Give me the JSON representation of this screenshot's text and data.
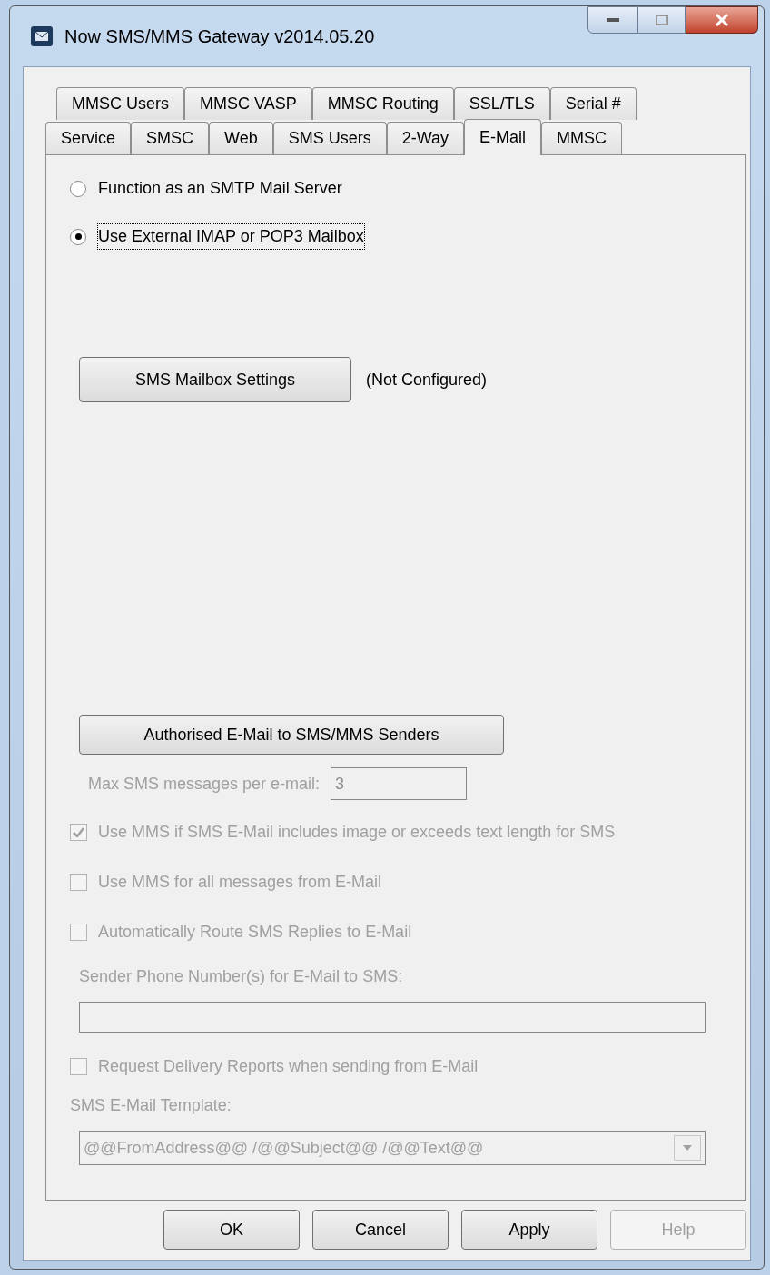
{
  "window": {
    "title": "Now SMS/MMS Gateway v2014.05.20"
  },
  "tab_rows": [
    [
      {
        "label": "MMSC Users",
        "selected": false
      },
      {
        "label": "MMSC VASP",
        "selected": false
      },
      {
        "label": "MMSC Routing",
        "selected": false
      },
      {
        "label": "SSL/TLS",
        "selected": false
      },
      {
        "label": "Serial #",
        "selected": false
      }
    ],
    [
      {
        "label": "Service",
        "selected": false
      },
      {
        "label": "SMSC",
        "selected": false
      },
      {
        "label": "Web",
        "selected": false
      },
      {
        "label": "SMS Users",
        "selected": false
      },
      {
        "label": "2-Way",
        "selected": false
      },
      {
        "label": "E-Mail",
        "selected": true
      },
      {
        "label": "MMSC",
        "selected": false
      }
    ]
  ],
  "mode_options": [
    {
      "label": "Function as an SMTP Mail Server",
      "selected": false
    },
    {
      "label": "Use External IMAP or POP3 Mailbox",
      "selected": true
    }
  ],
  "mailbox_button": {
    "label": "SMS Mailbox Settings",
    "status": "(Not Configured)"
  },
  "senders_button": {
    "label": "Authorised E-Mail to SMS/MMS Senders"
  },
  "max_messages": {
    "label": "Max SMS messages per e-mail:",
    "value": "3",
    "disabled": true
  },
  "options": [
    {
      "label": "Use MMS if SMS E-Mail includes image or exceeds text length for SMS",
      "checked": true,
      "disabled": true
    },
    {
      "label": "Use MMS for all messages from E-Mail",
      "checked": false,
      "disabled": true
    },
    {
      "label": "Automatically Route SMS Replies to E-Mail",
      "checked": false,
      "disabled": true
    }
  ],
  "sender_numbers": {
    "label": "Sender Phone Number(s) for E-Mail to SMS:",
    "disabled": true
  },
  "delivery_reports": {
    "label": "Request Delivery Reports when sending from E-Mail",
    "checked": false,
    "disabled": true
  },
  "template": {
    "label": "SMS E-Mail Template:",
    "value": "@@FromAddress@@ /@@Subject@@ /@@Text@@",
    "disabled": true
  },
  "buttons": [
    {
      "label": "OK",
      "disabled": false
    },
    {
      "label": "Cancel",
      "disabled": false
    },
    {
      "label": "Apply",
      "disabled": false
    },
    {
      "label": "Help",
      "disabled": true
    }
  ]
}
